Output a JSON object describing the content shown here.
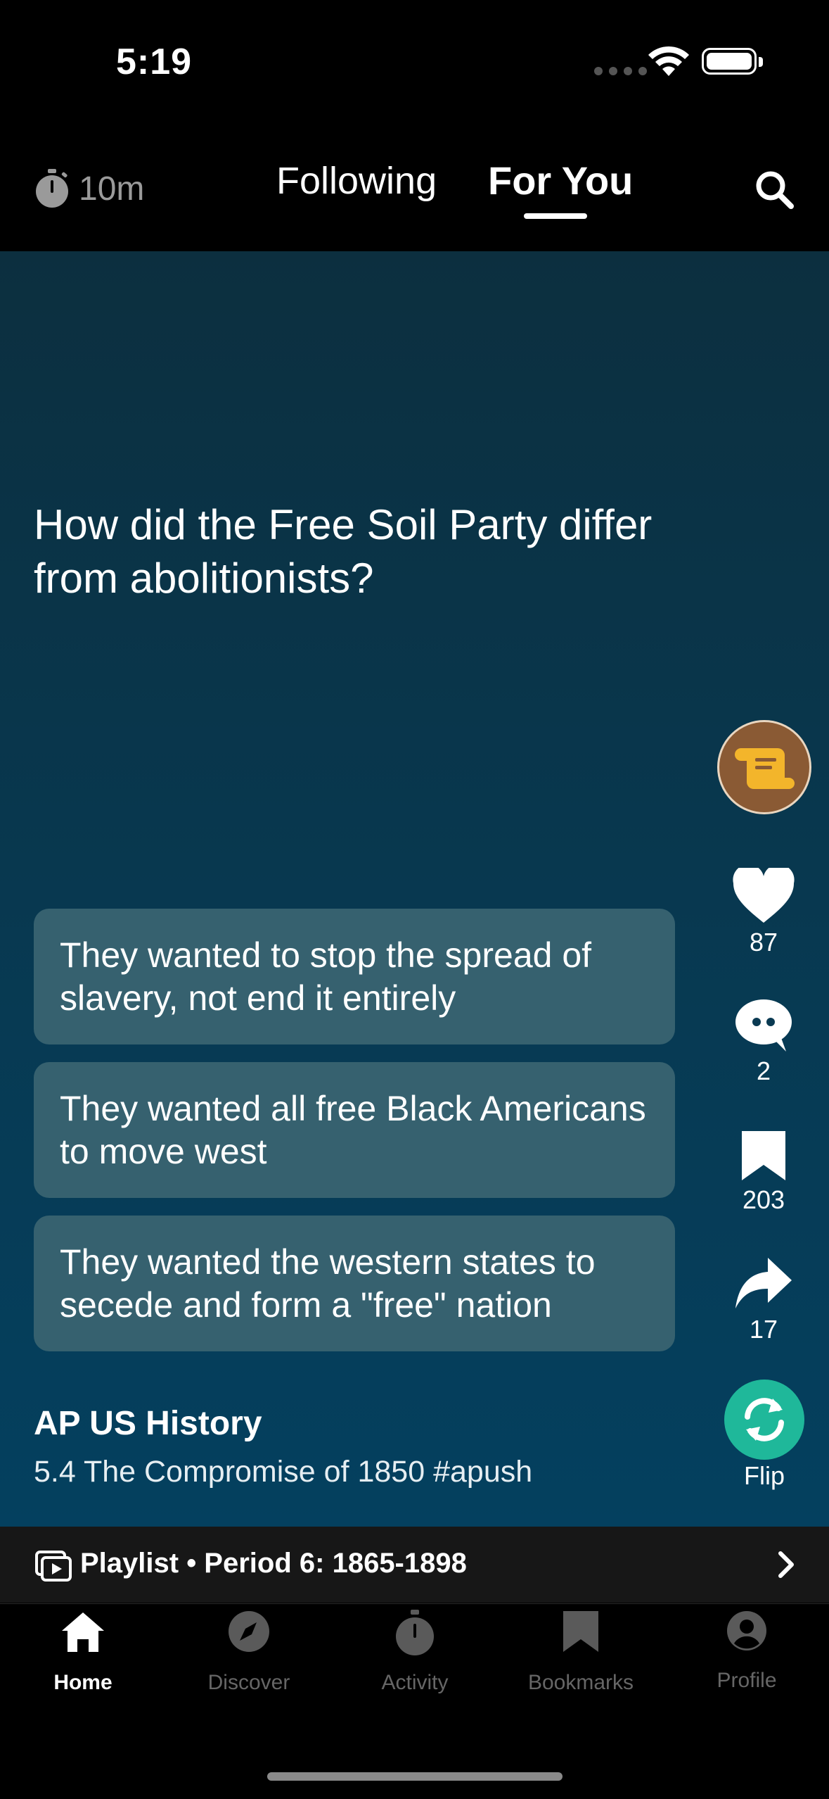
{
  "status_bar": {
    "time": "5:19"
  },
  "top_nav": {
    "timer_label": "10m",
    "tabs": [
      {
        "label": "Following",
        "active": false
      },
      {
        "label": "For You",
        "active": true
      }
    ]
  },
  "card": {
    "question": "How did the Free Soil Party differ from abolitionists?",
    "answers": [
      "They wanted to stop the spread of slavery, not end it entirely",
      "They wanted all free Black Americans to move west",
      "They wanted the western states to secede and form a \"free\" nation"
    ],
    "course_title": "AP US History",
    "course_subtitle": "5.4 The Compromise of 1850 #apush"
  },
  "actions": {
    "likes": "87",
    "comments": "2",
    "bookmarks": "203",
    "shares": "17",
    "flip_label": "Flip"
  },
  "playlist": {
    "label": "Playlist • Period 6: 1865-1898"
  },
  "tab_bar": {
    "items": [
      {
        "label": "Home",
        "icon": "home-icon",
        "active": true
      },
      {
        "label": "Discover",
        "icon": "compass-icon",
        "active": false
      },
      {
        "label": "Activity",
        "icon": "stopwatch-icon",
        "active": false
      },
      {
        "label": "Bookmarks",
        "icon": "bookmark-icon",
        "active": false
      },
      {
        "label": "Profile",
        "icon": "person-icon",
        "active": false
      }
    ]
  },
  "colors": {
    "answer_bg": "#36616f",
    "flip_green": "#1fb89a",
    "avatar_brown": "#8a5a34",
    "avatar_icon_yellow": "#f3b52b"
  }
}
